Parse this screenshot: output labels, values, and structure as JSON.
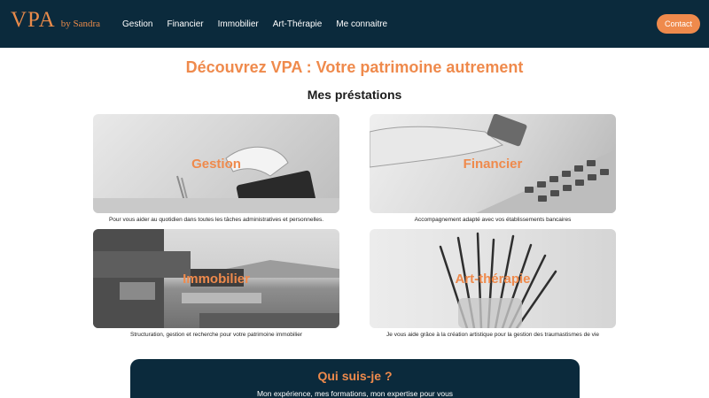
{
  "brand": {
    "name": "VPA",
    "subtitle": "by Sandra"
  },
  "nav": {
    "items": [
      "Gestion",
      "Financier",
      "Immobilier",
      "Art-Thérapie",
      "Me connaitre"
    ],
    "contact_label": "Contact"
  },
  "hero": {
    "title": "Découvrez VPA : Votre patrimoine autrement"
  },
  "services": {
    "title": "Mes préstations",
    "cards": [
      {
        "title": "Gestion",
        "description": "Pour vous aider au quotidien dans toutes les tâches administratives et personnelles."
      },
      {
        "title": "Financier",
        "description": "Accompagnement adapté avec vos établissements bancaires"
      },
      {
        "title": "Immobilier",
        "description": "Structuration, gestion et recherche pour votre patrimoine immobilier"
      },
      {
        "title": "Art-thérapie",
        "description": "Je vous aide grâce à la création artistique pour la gestion des traumastismes de vie"
      }
    ]
  },
  "about": {
    "title": "Qui suis-je ?",
    "subtitle": "Mon expérience, mes formations, mon expertise pour vous"
  },
  "colors": {
    "navy": "#0b2a3c",
    "accent": "#ef8a4c"
  }
}
